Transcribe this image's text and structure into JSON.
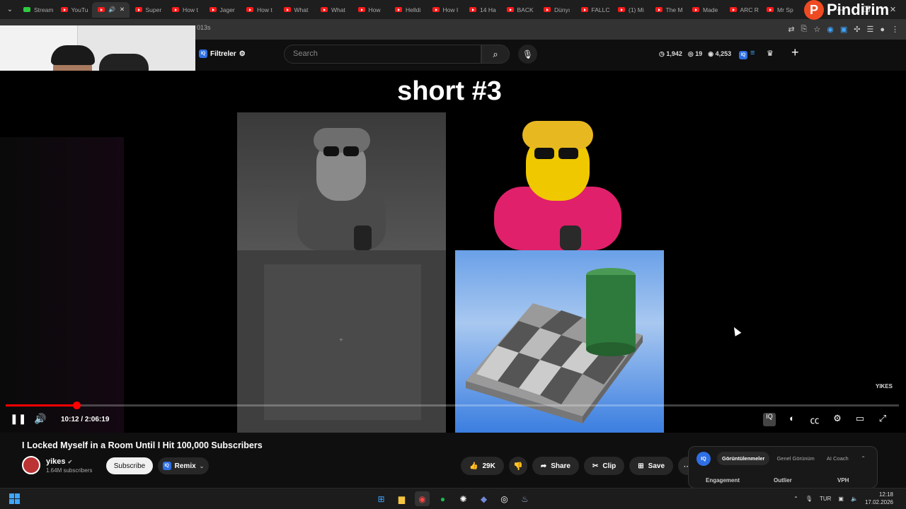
{
  "browser": {
    "tabs": [
      {
        "label": "Stream",
        "icon": "kick-icon"
      },
      {
        "label": "YouTu",
        "icon": "youtube-icon"
      },
      {
        "label": "",
        "icon": "youtube-icon",
        "active": true
      },
      {
        "label": "Super",
        "icon": "youtube-icon"
      },
      {
        "label": "How t",
        "icon": "youtube-icon"
      },
      {
        "label": "Jager",
        "icon": "youtube-icon"
      },
      {
        "label": "How t",
        "icon": "youtube-icon"
      },
      {
        "label": "What",
        "icon": "youtube-icon"
      },
      {
        "label": "What",
        "icon": "youtube-icon"
      },
      {
        "label": "How",
        "icon": "youtube-icon"
      },
      {
        "label": "Helldi",
        "icon": "youtube-icon"
      },
      {
        "label": "How I",
        "icon": "youtube-icon"
      },
      {
        "label": "14 Ha",
        "icon": "youtube-icon"
      },
      {
        "label": "BACK",
        "icon": "youtube-icon"
      },
      {
        "label": "Dünyı",
        "icon": "youtube-icon"
      },
      {
        "label": "FALLC",
        "icon": "youtube-icon"
      },
      {
        "label": "(1) Mi",
        "icon": "youtube-icon"
      },
      {
        "label": "The M",
        "icon": "youtube-icon"
      },
      {
        "label": "Made",
        "icon": "youtube-icon"
      },
      {
        "label": "ARC R",
        "icon": "youtube-icon"
      },
      {
        "label": "Mr Sp",
        "icon": "youtube-icon"
      }
    ],
    "url_fragment": "013s"
  },
  "youtube_header": {
    "filters_label": "Filtreler",
    "search_placeholder": "Search",
    "stat1": "1,942",
    "stat2": "19",
    "stat3": "4,253"
  },
  "overlay_brand": "Pindirim",
  "video": {
    "frame_title": "short #3",
    "watermark": "YIKES",
    "time": "10:12 / 2:06:19",
    "progress_fraction": 0.079
  },
  "below": {
    "title": "I Locked Myself in a Room Until I Hit 100,000 Subscribers",
    "channel": "yikes",
    "subscribers": "1.64M subscribers",
    "subscribe_label": "Subscribe",
    "remix_label": "Remix",
    "likes": "29K",
    "share_label": "Share",
    "clip_label": "Clip",
    "save_label": "Save"
  },
  "iq_panel": {
    "tabs": [
      "Görüntülenmeler",
      "Genel Görünüm",
      "AI Coach"
    ],
    "columns": [
      "Engagement",
      "Outlier",
      "VPH"
    ]
  },
  "taskbar": {
    "lang": "TUR",
    "time": "12:18",
    "date": "17.02.2026"
  },
  "colors": {
    "accent": "#ff0000",
    "iq": "#2f6fe4",
    "brand": "#f04a23"
  }
}
